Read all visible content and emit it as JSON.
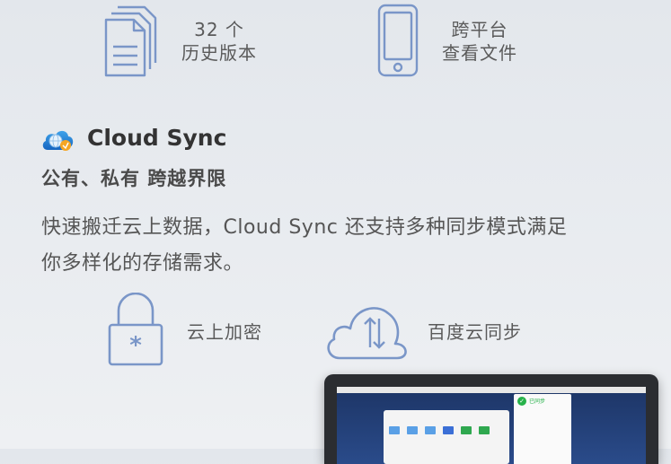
{
  "features_top": [
    {
      "line1": "32 个",
      "line2": "历史版本",
      "icon": "document-versions-icon"
    },
    {
      "line1": "跨平台",
      "line2": "查看文件",
      "icon": "mobile-phone-icon"
    }
  ],
  "app": {
    "name": "Cloud Sync",
    "logo_icon": "cloud-sync-logo-icon"
  },
  "tagline": "公有、私有 跨越界限",
  "description": {
    "line1": "快速搬迁云上数据，Cloud Sync 还支持多种同步模式满足",
    "line2": "你多样化的存储需求。"
  },
  "features_bottom": [
    {
      "label": "云上加密",
      "icon": "padlock-icon"
    },
    {
      "label": "百度云同步",
      "icon": "cloud-sync-arrows-icon"
    }
  ],
  "laptop_screen": {
    "panel_title": "已同步",
    "panel_check": "✓"
  },
  "colors": {
    "icon_stroke": "#7a96c8",
    "text": "#5a5a5a",
    "heading": "#333333"
  }
}
